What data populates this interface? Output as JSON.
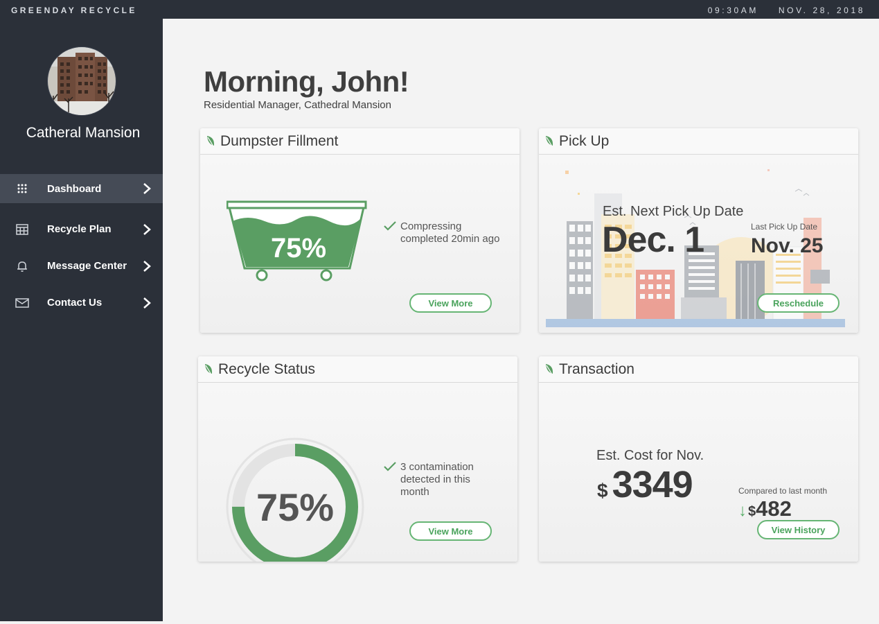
{
  "topbar": {
    "brand": "GREENDAY RECYCLE",
    "time": "09:30AM",
    "date": "NOV. 28, 2018"
  },
  "sidebar": {
    "building_name": "Catheral Mansion",
    "items": [
      {
        "label": "Dashboard",
        "icon": "grid-icon",
        "active": true
      },
      {
        "label": "Recycle Plan",
        "icon": "calendar-icon",
        "active": false
      },
      {
        "label": "Message Center",
        "icon": "bell-icon",
        "active": false
      },
      {
        "label": "Contact Us",
        "icon": "envelope-icon",
        "active": false
      }
    ]
  },
  "header": {
    "greeting": "Morning, John!",
    "role": "Residential Manager, Cathedral Mansion"
  },
  "cards": {
    "dumpster": {
      "title": "Dumpster Fillment",
      "percent_label": "75%",
      "fill_fraction": 0.75,
      "note": "Compressing completed 20min ago",
      "button": "View More"
    },
    "pickup": {
      "title": "Pick Up",
      "next_label": "Est. Next Pick Up Date",
      "next_date": "Dec. 1",
      "last_label": "Last Pick Up Date",
      "last_date": "Nov. 25",
      "button": "Reschedule"
    },
    "status": {
      "title": "Recycle Status",
      "percent_label": "75%",
      "progress_fraction": 0.75,
      "note": "3 contamination detected in this month",
      "button": "View More"
    },
    "transaction": {
      "title": "Transaction",
      "cost_label": "Est. Cost for Nov.",
      "currency": "$",
      "cost": "3349",
      "compare_label": "Compared to last month",
      "compare_value": "482",
      "compare_direction": "down",
      "button": "View History"
    }
  },
  "colors": {
    "sidebar_bg": "#2b3039",
    "accent_green": "#5a9e63",
    "button_green": "#66b574",
    "background": "#f3f3f3"
  }
}
